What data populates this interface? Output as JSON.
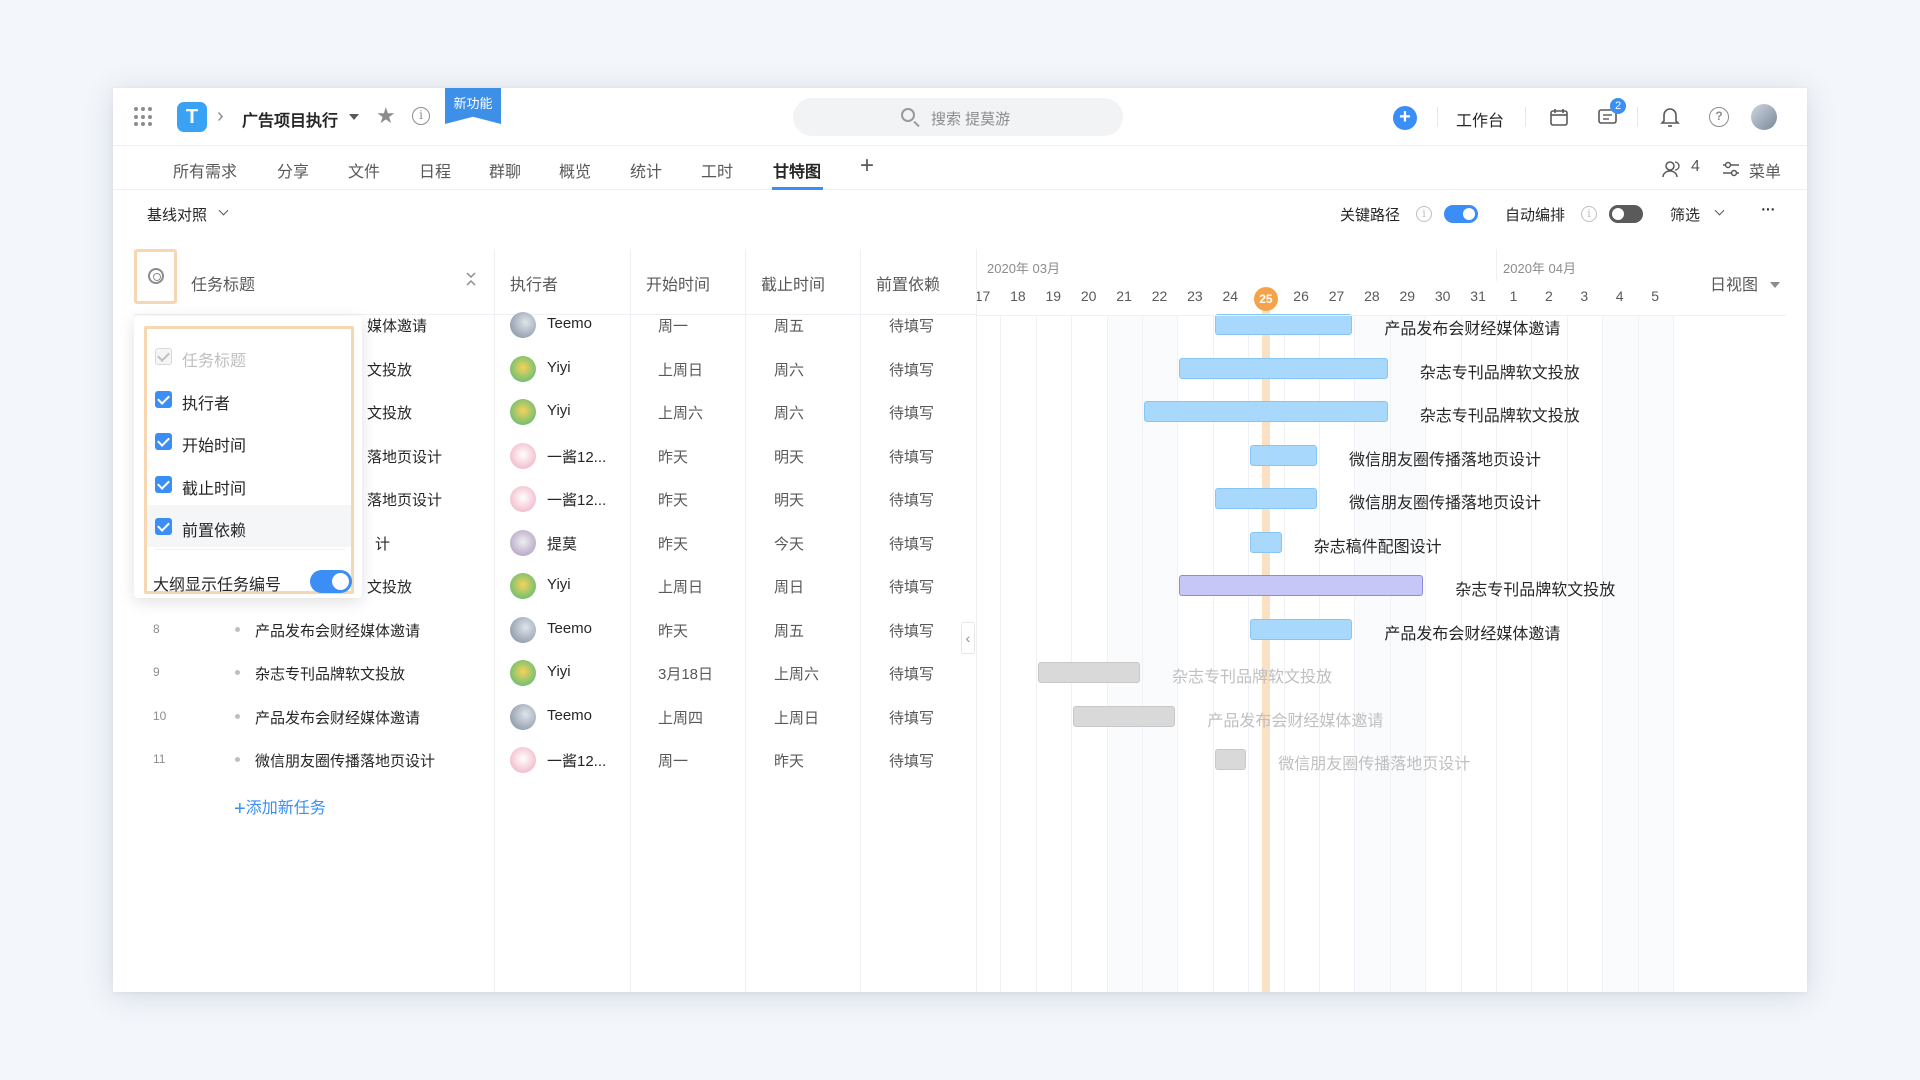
{
  "topbar": {
    "app_logo": "T",
    "project_title": "广告项目执行",
    "new_feature_badge": "新功能",
    "search_placeholder": "搜索 提莫游",
    "workbench": "工作台",
    "message_count": "2"
  },
  "tabs": [
    "所有需求",
    "分享",
    "文件",
    "日程",
    "群聊",
    "概览",
    "统计",
    "工时",
    "甘特图"
  ],
  "active_tab": "甘特图",
  "tabbar_right": {
    "members_count": "4",
    "menu": "菜单"
  },
  "toolbar": {
    "baseline": "基线对照",
    "critical_path": "关键路径",
    "critical_path_on": true,
    "auto_schedule": "自动编排",
    "auto_schedule_on": false,
    "filter": "筛选",
    "more": "···"
  },
  "columns": {
    "title": "任务标题",
    "assignee": "执行者",
    "start": "开始时间",
    "end": "截止时间",
    "dependency": "前置依赖"
  },
  "settings_popup": {
    "options": [
      {
        "label": "任务标题",
        "checked": true,
        "disabled": true
      },
      {
        "label": "执行者",
        "checked": true,
        "disabled": false
      },
      {
        "label": "开始时间",
        "checked": true,
        "disabled": false
      },
      {
        "label": "截止时间",
        "checked": true,
        "disabled": false
      },
      {
        "label": "前置依赖",
        "checked": true,
        "disabled": false
      }
    ],
    "outline_number_label": "大纲显示任务编号",
    "outline_number_on": true
  },
  "tasks": [
    {
      "num": "",
      "title": "媒体邀请",
      "assignee": "Teemo",
      "start": "周一",
      "end": "周五",
      "dep": "待填写"
    },
    {
      "num": "",
      "title": "文投放",
      "assignee": "Yiyi",
      "start": "上周日",
      "end": "周六",
      "dep": "待填写"
    },
    {
      "num": "",
      "title": "文投放",
      "assignee": "Yiyi",
      "start": "上周六",
      "end": "周六",
      "dep": "待填写"
    },
    {
      "num": "",
      "title": "落地页设计",
      "assignee": "一酱12...",
      "start": "昨天",
      "end": "明天",
      "dep": "待填写"
    },
    {
      "num": "",
      "title": "落地页设计",
      "assignee": "一酱12...",
      "start": "昨天",
      "end": "明天",
      "dep": "待填写"
    },
    {
      "num": "",
      "title": "计",
      "assignee": "提莫",
      "start": "昨天",
      "end": "今天",
      "dep": "待填写"
    },
    {
      "num": "",
      "title": "文投放",
      "assignee": "Yiyi",
      "start": "上周日",
      "end": "周日",
      "dep": "待填写"
    },
    {
      "num": "8",
      "title": "产品发布会财经媒体邀请",
      "assignee": "Teemo",
      "start": "昨天",
      "end": "周五",
      "dep": "待填写"
    },
    {
      "num": "9",
      "title": "杂志专刊品牌软文投放",
      "assignee": "Yiyi",
      "start": "3月18日",
      "end": "上周六",
      "dep": "待填写"
    },
    {
      "num": "10",
      "title": "产品发布会财经媒体邀请",
      "assignee": "Teemo",
      "start": "上周四",
      "end": "上周日",
      "dep": "待填写"
    },
    {
      "num": "11",
      "title": "微信朋友圈传播落地页设计",
      "assignee": "一酱12...",
      "start": "周一",
      "end": "昨天",
      "dep": "待填写"
    }
  ],
  "add_task": "添加新任务",
  "gantt": {
    "view": "日视图",
    "months": [
      {
        "label": "2020年 03月"
      },
      {
        "label": "2020年 04月"
      }
    ],
    "days": [
      "17",
      "18",
      "19",
      "20",
      "21",
      "22",
      "23",
      "24",
      "25",
      "26",
      "27",
      "28",
      "29",
      "30",
      "31",
      "1",
      "2",
      "3",
      "4",
      "5"
    ],
    "today": "25",
    "bars": [
      {
        "label": "产品发布会财经媒体邀请",
        "start": "24",
        "end": "27",
        "style": "blue"
      },
      {
        "label": "杂志专刊品牌软文投放",
        "start": "23",
        "end": "28",
        "style": "blue"
      },
      {
        "label": "杂志专刊品牌软文投放",
        "start": "22",
        "end": "28",
        "style": "blue"
      },
      {
        "label": "微信朋友圈传播落地页设计",
        "start": "25",
        "end": "26",
        "style": "blue"
      },
      {
        "label": "微信朋友圈传播落地页设计",
        "start": "24",
        "end": "26",
        "style": "blue"
      },
      {
        "label": "杂志稿件配图设计",
        "start": "25",
        "end": "25",
        "style": "blue"
      },
      {
        "label": "杂志专刊品牌软文投放",
        "start": "23",
        "end": "29",
        "style": "purple"
      },
      {
        "label": "产品发布会财经媒体邀请",
        "start": "25",
        "end": "27",
        "style": "blue"
      },
      {
        "label": "杂志专刊品牌软文投放",
        "start": "19",
        "end": "21",
        "style": "gray"
      },
      {
        "label": "产品发布会财经媒体邀请",
        "start": "20",
        "end": "22",
        "style": "gray"
      },
      {
        "label": "微信朋友圈传播落地页设计",
        "start": "24",
        "end": "24",
        "style": "gray"
      }
    ]
  },
  "colors": {
    "accent": "#3a8ef6",
    "today": "#f5a34a",
    "highlight": "#f7d7b2"
  }
}
